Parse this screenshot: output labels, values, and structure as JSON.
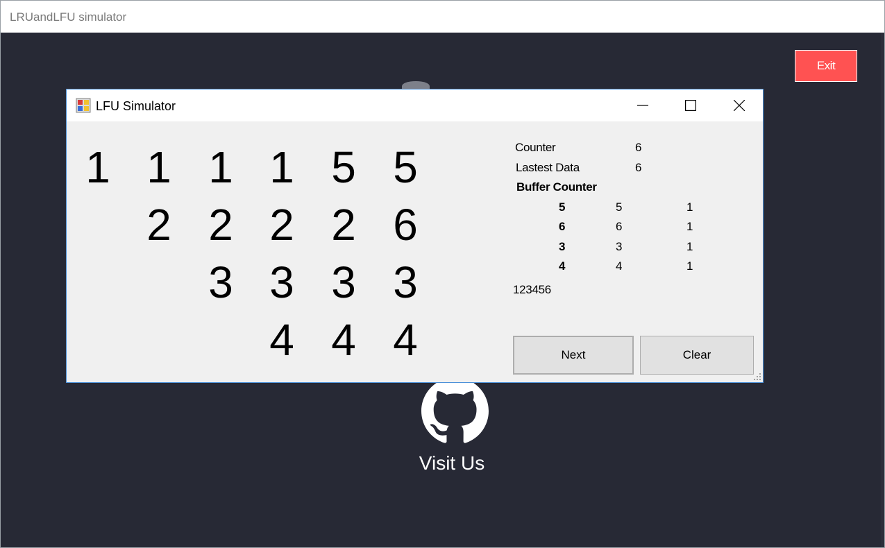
{
  "main_window": {
    "title": "LRUandLFU simulator",
    "exit_label": "Exit",
    "visit_label": "Visit Us"
  },
  "lfu_window": {
    "title": "LFU Simulator",
    "columns": [
      [
        "1",
        "",
        "",
        ""
      ],
      [
        "1",
        "2",
        "",
        ""
      ],
      [
        "1",
        "2",
        "3",
        ""
      ],
      [
        "1",
        "2",
        "3",
        "4"
      ],
      [
        "5",
        "2",
        "3",
        "4"
      ],
      [
        "5",
        "6",
        "3",
        "4"
      ]
    ],
    "counter_label": "Counter",
    "counter_value": "6",
    "latest_label": "Lastest Data",
    "latest_value": "6",
    "buffer_header": "Buffer Counter",
    "buffer_rows": [
      [
        "5",
        "5",
        "1"
      ],
      [
        "6",
        "6",
        "1"
      ],
      [
        "3",
        "3",
        "1"
      ],
      [
        "4",
        "4",
        "1"
      ]
    ],
    "sequence": "123456",
    "next_label": "Next",
    "clear_label": "Clear"
  }
}
